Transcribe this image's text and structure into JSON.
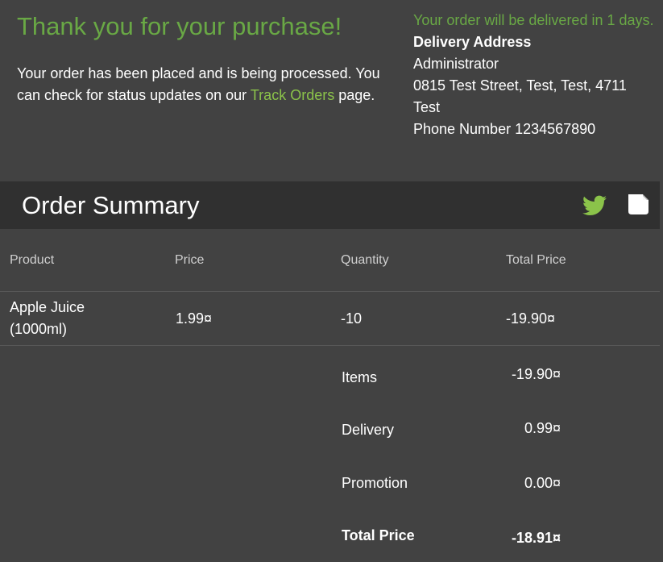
{
  "confirmation": {
    "title": "Thank you for your purchase!",
    "message_before_link": "Your order has been placed and is being processed. You can check for status updates on our ",
    "link_text": "Track Orders",
    "message_after_link": " page."
  },
  "delivery": {
    "eta_text": "Your order will be delivered in 1 days.",
    "address_heading": "Delivery Address",
    "name": "Administrator",
    "address_line1": "0815 Test Street, Test, Test, 4711",
    "address_line2": "Test",
    "phone": "Phone Number 1234567890"
  },
  "summary": {
    "title": "Order Summary",
    "icons": [
      "twitter-icon",
      "note-icon"
    ],
    "twitter_color": "#8bc34a"
  },
  "table": {
    "headers": [
      "Product",
      "Price",
      "Quantity",
      "Total Price"
    ],
    "rows": [
      {
        "product": "Apple Juice (1000ml)",
        "price": "1.99¤",
        "quantity": "-10",
        "total": "-19.90¤"
      }
    ]
  },
  "totals": {
    "items_label": "Items",
    "items_value": "-19.90¤",
    "delivery_label": "Delivery",
    "delivery_value": "0.99¤",
    "promotion_label": "Promotion",
    "promotion_value": "0.00¤",
    "total_label": "Total Price",
    "total_value": "-18.91¤"
  }
}
